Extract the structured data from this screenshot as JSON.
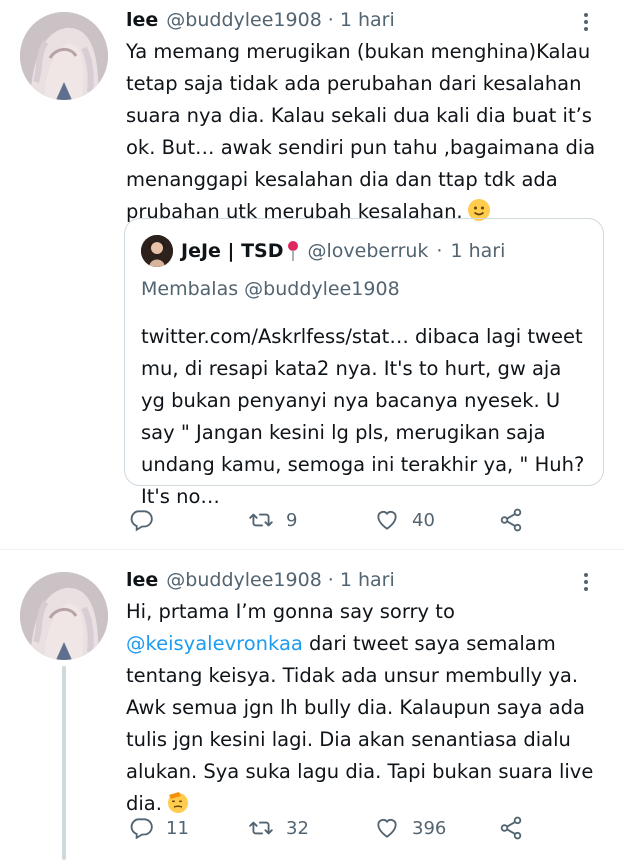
{
  "tweets": [
    {
      "name": "lee",
      "handle": "@buddylee1908",
      "dot": "·",
      "time": "1 hari",
      "text": "Ya memang merugikan (bukan menghina)Kalau tetap saja tidak ada perubahan dari kesalahan suara nya dia. Kalau sekali dua kali dia buat it’s ok. But… awak sendiri pun tahu ,bagaimana dia menanggapi kesalahan dia dan ttap tdk ada prubahan utk merubah kesalahan.",
      "emoji_icon": "slightly-smiling-face-icon",
      "quote": {
        "name": "JeJe | TSD",
        "pin_icon": "round-pushpin-icon",
        "handle": "@loveberruk",
        "dot": "·",
        "time": "1 hari",
        "reply_prefix": "Membalas",
        "reply_to": "@buddylee1908",
        "text": "twitter.com/Askrlfess/stat… dibaca lagi tweet mu, di resapi kata2 nya. It's to hurt, gw aja yg bukan penyanyi nya bacanya nyesek. U say \" Jangan kesini lg pls, merugikan saja undang kamu, semoga ini terakhir ya, \" Huh? It's no…"
      },
      "replies": "",
      "retweets": "9",
      "likes": "40"
    },
    {
      "name": "lee",
      "handle": "@buddylee1908",
      "dot": "·",
      "time": "1 hari",
      "text_before": "Hi, prtama I’m gonna say sorry to ",
      "mention": "@keisyalevronkaa",
      "text_after": " dari tweet saya semalam tentang keisya. Tidak ada unsur membully ya. Awk semua jgn lh bully dia. Kalaupun saya ada tulis jgn kesini lagi. Dia akan senantiasa dialu alukan. Sya suka lagu dia. Tapi bukan suara live dia.",
      "emoji_icon": "saluting-face-icon",
      "replies": "11",
      "retweets": "32",
      "likes": "396"
    }
  ],
  "colors": {
    "text": "#0f1419",
    "secondary": "#536471",
    "link": "#1d9bf0",
    "border": "#cfd9de"
  }
}
